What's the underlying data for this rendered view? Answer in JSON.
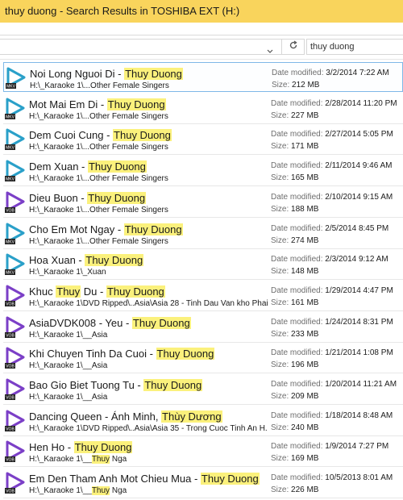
{
  "window": {
    "title": "thuy duong - Search Results in TOSHIBA EXT (H:)"
  },
  "search": {
    "value": "thuy duong"
  },
  "icons": {
    "refresh": "refresh-icon",
    "dropdown": "chevron-down-icon",
    "media": "media-file-icon"
  },
  "colors": {
    "titlebar": "#f9d45c",
    "highlight": "#fbf17c",
    "mkv_icon": "#2aa0c9",
    "vob_icon": "#7b3fc7"
  },
  "labels": {
    "date_modified": "Date modified:",
    "size": "Size:"
  },
  "files": [
    {
      "title": "Noi Long Nguoi Di - ",
      "title_hl": "Thuy Duong",
      "path": "H:\\_Karaoke 1\\...Other Female Singers",
      "path_pre": "",
      "path_hl": "",
      "path_post": "",
      "date": "3/2/2014 7:22 AM",
      "size": "212 MB",
      "type": "MKV",
      "selected": true
    },
    {
      "title": "Mot Mai Em Di - ",
      "title_hl": "Thuy Duong",
      "path": "H:\\_Karaoke 1\\...Other Female Singers",
      "path_pre": "",
      "path_hl": "",
      "path_post": "",
      "date": "2/28/2014 11:20 PM",
      "size": "227 MB",
      "type": "MKV"
    },
    {
      "title": "Dem Cuoi Cung - ",
      "title_hl": "Thuy Duong",
      "path": "H:\\_Karaoke 1\\...Other Female Singers",
      "path_pre": "",
      "path_hl": "",
      "path_post": "",
      "date": "2/27/2014 5:05 PM",
      "size": "171 MB",
      "type": "MKV"
    },
    {
      "title": "Dem Xuan - ",
      "title_hl": "Thuy Duong",
      "path": "H:\\_Karaoke 1\\...Other Female Singers",
      "path_pre": "",
      "path_hl": "",
      "path_post": "",
      "date": "2/11/2014 9:46 AM",
      "size": "165 MB",
      "type": "MKV"
    },
    {
      "title": "Dieu Buon - ",
      "title_hl": "Thuy Duong",
      "path": "H:\\_Karaoke 1\\...Other Female Singers",
      "path_pre": "",
      "path_hl": "",
      "path_post": "",
      "date": "2/10/2014 9:15 AM",
      "size": "188 MB",
      "type": "VOB"
    },
    {
      "title": "Cho Em Mot Ngay - ",
      "title_hl": "Thuy Duong",
      "path": "H:\\_Karaoke 1\\...Other Female Singers",
      "path_pre": "",
      "path_hl": "",
      "path_post": "",
      "date": "2/5/2014 8:45 PM",
      "size": "274 MB",
      "type": "MKV"
    },
    {
      "title": "Hoa Xuan - ",
      "title_hl": "Thuy Duong",
      "path": "H:\\_Karaoke 1\\_Xuan",
      "path_pre": "",
      "path_hl": "",
      "path_post": "",
      "date": "2/3/2014 9:12 AM",
      "size": "148 MB",
      "type": "MKV"
    },
    {
      "title": "Khuc ",
      "title_hl": "Thuy",
      "title_mid": " Du - ",
      "title_hl2": "Thuy Duong",
      "path": "H:\\_Karaoke 1\\DVD Ripped\\..Asia\\Asia 28 - Tinh Dau Van kho Phai",
      "path_pre": "",
      "path_hl": "",
      "path_post": "",
      "date": "1/29/2014 4:47 PM",
      "size": "161 MB",
      "type": "VOB"
    },
    {
      "title": "AsiaDVDK008 - Yeu - ",
      "title_hl": "Thuy Duong",
      "path": "H:\\_Karaoke 1\\__Asia",
      "path_pre": "",
      "path_hl": "",
      "path_post": "",
      "date": "1/24/2014 8:31 PM",
      "size": "233 MB",
      "type": "VOB"
    },
    {
      "title": "Khi Chuyen Tinh Da Cuoi - ",
      "title_hl": "Thuy Duong",
      "path": "H:\\_Karaoke 1\\__Asia",
      "path_pre": "",
      "path_hl": "",
      "path_post": "",
      "date": "1/21/2014 1:08 PM",
      "size": "196 MB",
      "type": "VOB"
    },
    {
      "title": "Bao Gio Biet Tuong Tu - ",
      "title_hl": "Thuy Duong",
      "path": "H:\\_Karaoke 1\\__Asia",
      "path_pre": "",
      "path_hl": "",
      "path_post": "",
      "date": "1/20/2014 11:21 AM",
      "size": "209 MB",
      "type": "VOB"
    },
    {
      "title": "Dancing Queen - Ánh Minh, ",
      "title_hl": "Thùy Dương",
      "path": "H:\\_Karaoke 1\\DVD Ripped\\..Asia\\Asia 35 - Trong Cuoc Tinh An H...",
      "path_pre": "",
      "path_hl": "",
      "path_post": "",
      "date": "1/18/2014 8:48 AM",
      "size": "240 MB",
      "type": "VOB"
    },
    {
      "title": "Hen Ho - ",
      "title_hl": "Thuy Duong",
      "path": "",
      "path_pre": "H:\\_Karaoke 1\\__",
      "path_hl": "Thuy",
      "path_post": " Nga",
      "date": "1/9/2014 7:27 PM",
      "size": "169 MB",
      "type": "VOB"
    },
    {
      "title": "Em Den Tham Anh Mot Chieu Mua - ",
      "title_hl": "Thuy Duong",
      "path": "",
      "path_pre": "H:\\_Karaoke 1\\__",
      "path_hl": "Thuy",
      "path_post": " Nga",
      "date": "10/5/2013 8:01 AM",
      "size": "226 MB",
      "type": "VOB"
    }
  ]
}
